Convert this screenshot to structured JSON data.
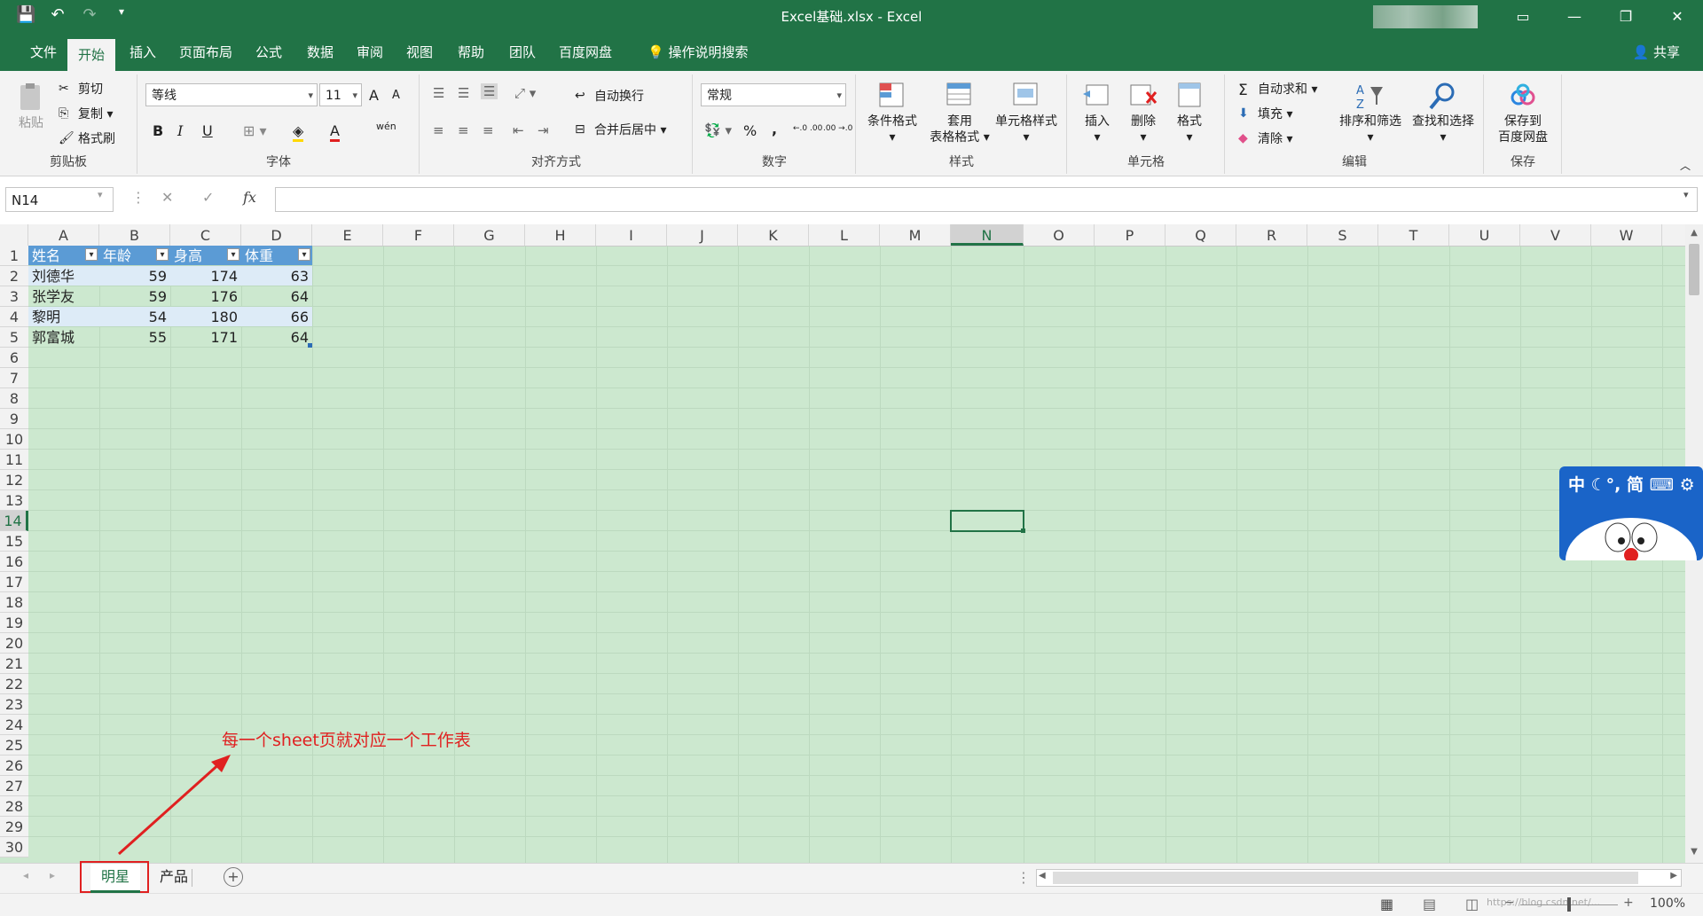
{
  "window": {
    "title": "Excel基础.xlsx  -  Excel",
    "controls": [
      "▭",
      "—",
      "❐",
      "✕"
    ]
  },
  "menu": {
    "tabs": [
      "文件",
      "开始",
      "插入",
      "页面布局",
      "公式",
      "数据",
      "审阅",
      "视图",
      "帮助",
      "团队",
      "百度网盘"
    ],
    "active_tab": "开始",
    "search_label": "操作说明搜索",
    "share_label": "共享"
  },
  "ribbon": {
    "clipboard": {
      "paste": "粘贴",
      "cut": "剪切",
      "copy": "复制",
      "format_painter": "格式刷",
      "label": "剪贴板"
    },
    "font": {
      "font_name": "等线",
      "font_size": "11",
      "bold": "B",
      "italic": "I",
      "underline": "U",
      "grow": "A",
      "shrink": "A",
      "font_color": "A",
      "phonetic": "wén",
      "label": "字体"
    },
    "alignment": {
      "wrap": "自动换行",
      "merge": "合并后居中",
      "label": "对齐方式"
    },
    "number": {
      "format": "常规",
      "percent": "%",
      "comma": ",",
      "inc_decimal": "←.0 .00",
      "dec_decimal": ".00 →.0",
      "label": "数字"
    },
    "styles": {
      "conditional": "条件格式",
      "table_format_1": "套用",
      "table_format_2": "表格格式",
      "cell_styles": "单元格样式",
      "label": "样式"
    },
    "cells": {
      "insert": "插入",
      "delete": "删除",
      "format": "格式",
      "label": "单元格"
    },
    "editing": {
      "autosum": "自动求和",
      "fill": "填充",
      "clear": "清除",
      "sort_filter": "排序和筛选",
      "find_select": "查找和选择",
      "label": "编辑"
    },
    "save": {
      "save_1": "保存到",
      "save_2": "百度网盘",
      "label": "保存"
    }
  },
  "formula_bar": {
    "name_box": "N14",
    "fx": "fx",
    "cancel": "✕",
    "enter": "✓",
    "value": ""
  },
  "sheet": {
    "columns": [
      "A",
      "B",
      "C",
      "D",
      "E",
      "F",
      "G",
      "H",
      "I",
      "J",
      "K",
      "L",
      "M",
      "N",
      "O",
      "P",
      "Q",
      "R",
      "S",
      "T",
      "U",
      "V",
      "W"
    ],
    "rows": [
      "1",
      "2",
      "3",
      "4",
      "5",
      "6",
      "7",
      "8",
      "9",
      "10",
      "11",
      "12",
      "13",
      "14",
      "15",
      "16",
      "17",
      "18",
      "19",
      "20",
      "21",
      "22",
      "23",
      "24",
      "25",
      "26",
      "27",
      "28",
      "29",
      "30"
    ],
    "selected_cell": "N14",
    "table": {
      "headers": [
        "姓名",
        "年龄",
        "身高",
        "体重"
      ],
      "rows": [
        [
          "刘德华",
          "59",
          "174",
          "63"
        ],
        [
          "张学友",
          "59",
          "176",
          "64"
        ],
        [
          "黎明",
          "54",
          "180",
          "66"
        ],
        [
          "郭富城",
          "55",
          "171",
          "64"
        ]
      ]
    }
  },
  "annotation": "每一个sheet页就对应一个工作表",
  "sheet_tabs": {
    "tabs": [
      "明星",
      "产品"
    ],
    "active": "明星",
    "add": "+"
  },
  "status": {
    "zoom": "100%",
    "watermark": "https://blog.csdn.net/..."
  },
  "ime": {
    "text": "中  ☾°,  简  ⌨ ⚙"
  },
  "colors": {
    "excel_green": "#217346",
    "sheet_bg": "#cce8cf",
    "table_header": "#5b9bd5",
    "table_band": "#ddebf7",
    "annotation_red": "#e02020"
  }
}
